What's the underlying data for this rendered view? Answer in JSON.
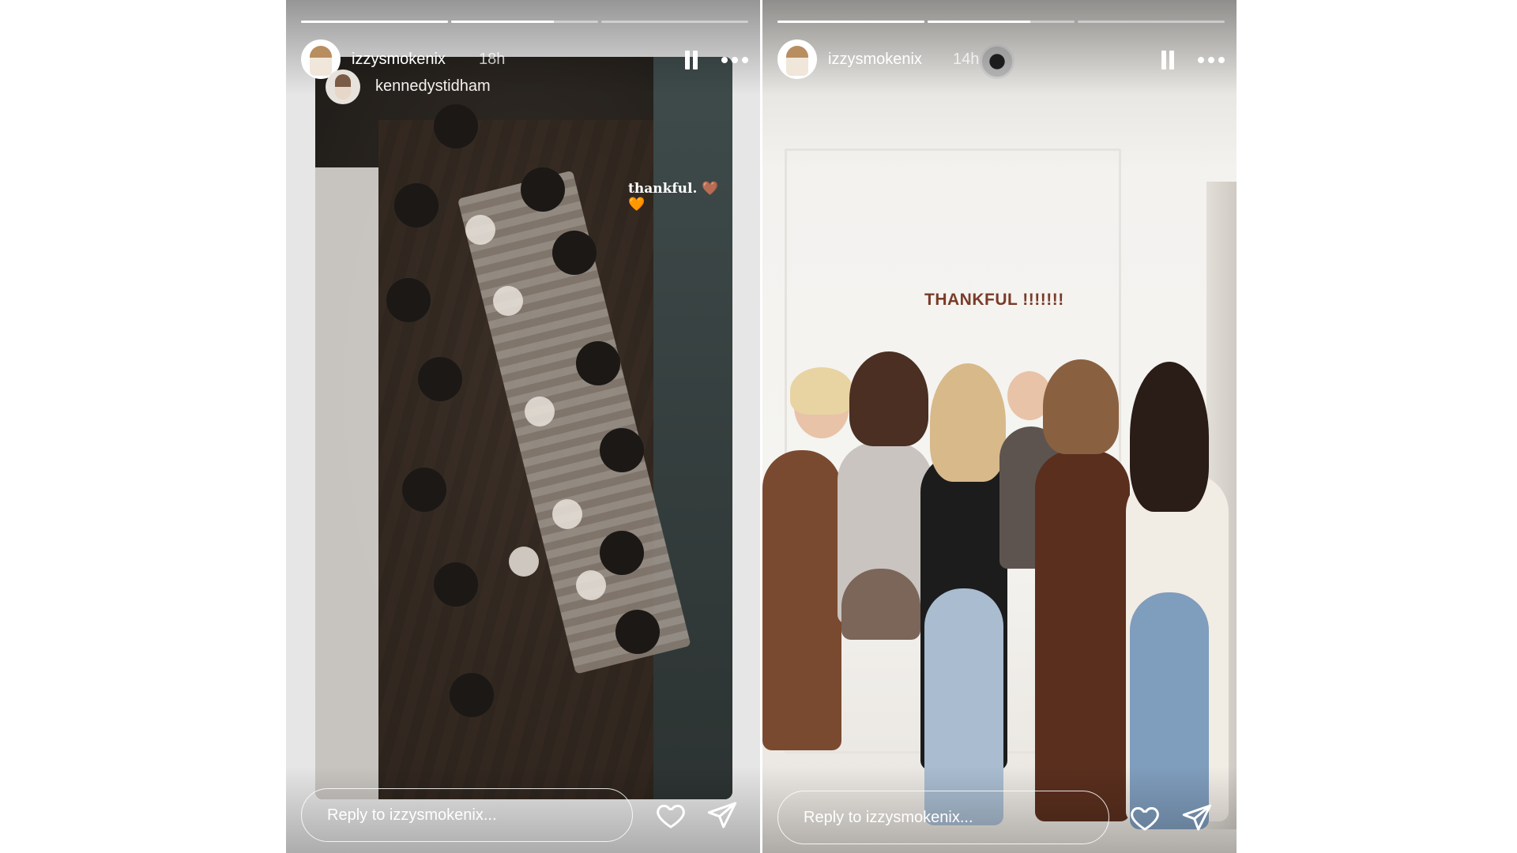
{
  "stories": [
    {
      "username": "izzysmokenix",
      "time": "18h",
      "progress": [
        1.0,
        0.7,
        0.0
      ],
      "repost_user": "kennedystidham",
      "overlay_text": "thankful. 🤎🧡",
      "reply_placeholder": "Reply to izzysmokenix..."
    },
    {
      "username": "izzysmokenix",
      "time": "14h",
      "progress": [
        1.0,
        0.7,
        0.0
      ],
      "overlay_text": "THANKFUL !!!!!!!",
      "reply_placeholder": "Reply to izzysmokenix..."
    }
  ],
  "icons": [
    "pause-icon",
    "more-icon",
    "heart-icon",
    "send-icon"
  ],
  "colors": {
    "overlay_text_right": "#7a3b28",
    "chrome": "#ffffff"
  }
}
